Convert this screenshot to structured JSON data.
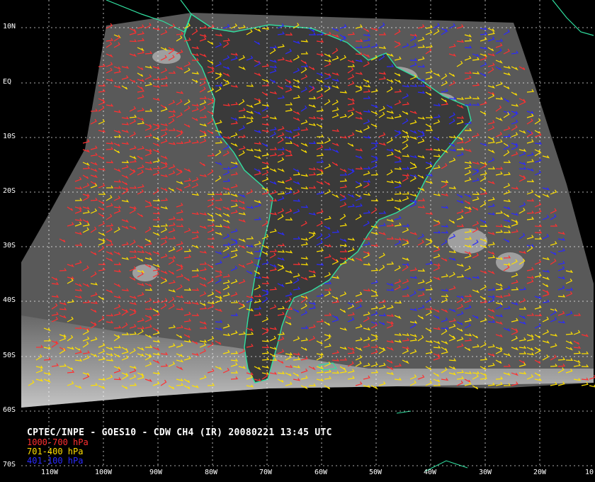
{
  "lat_labels": [
    "10N",
    "EQ",
    "10S",
    "20S",
    "30S",
    "40S",
    "50S",
    "60S",
    "70S"
  ],
  "lon_labels": [
    "110W",
    "100W",
    "90W",
    "80W",
    "70W",
    "60W",
    "50W",
    "40W",
    "30W",
    "20W",
    "10"
  ],
  "caption": "CPTEC/INPE - GOES10 - CDW CH4 (IR) 20080221 13:45 UTC",
  "legend": [
    {
      "label": "1000-700 hPa",
      "color": "#ff3030"
    },
    {
      "label": "701-400 hPa",
      "color": "#ffe000"
    },
    {
      "label": "401-100 hPa",
      "color": "#2a2aff"
    }
  ],
  "colors": {
    "coast": "#30e0a0",
    "grid": "#ffffff",
    "background": "#000000",
    "image_gray": "#5a5a5a"
  }
}
